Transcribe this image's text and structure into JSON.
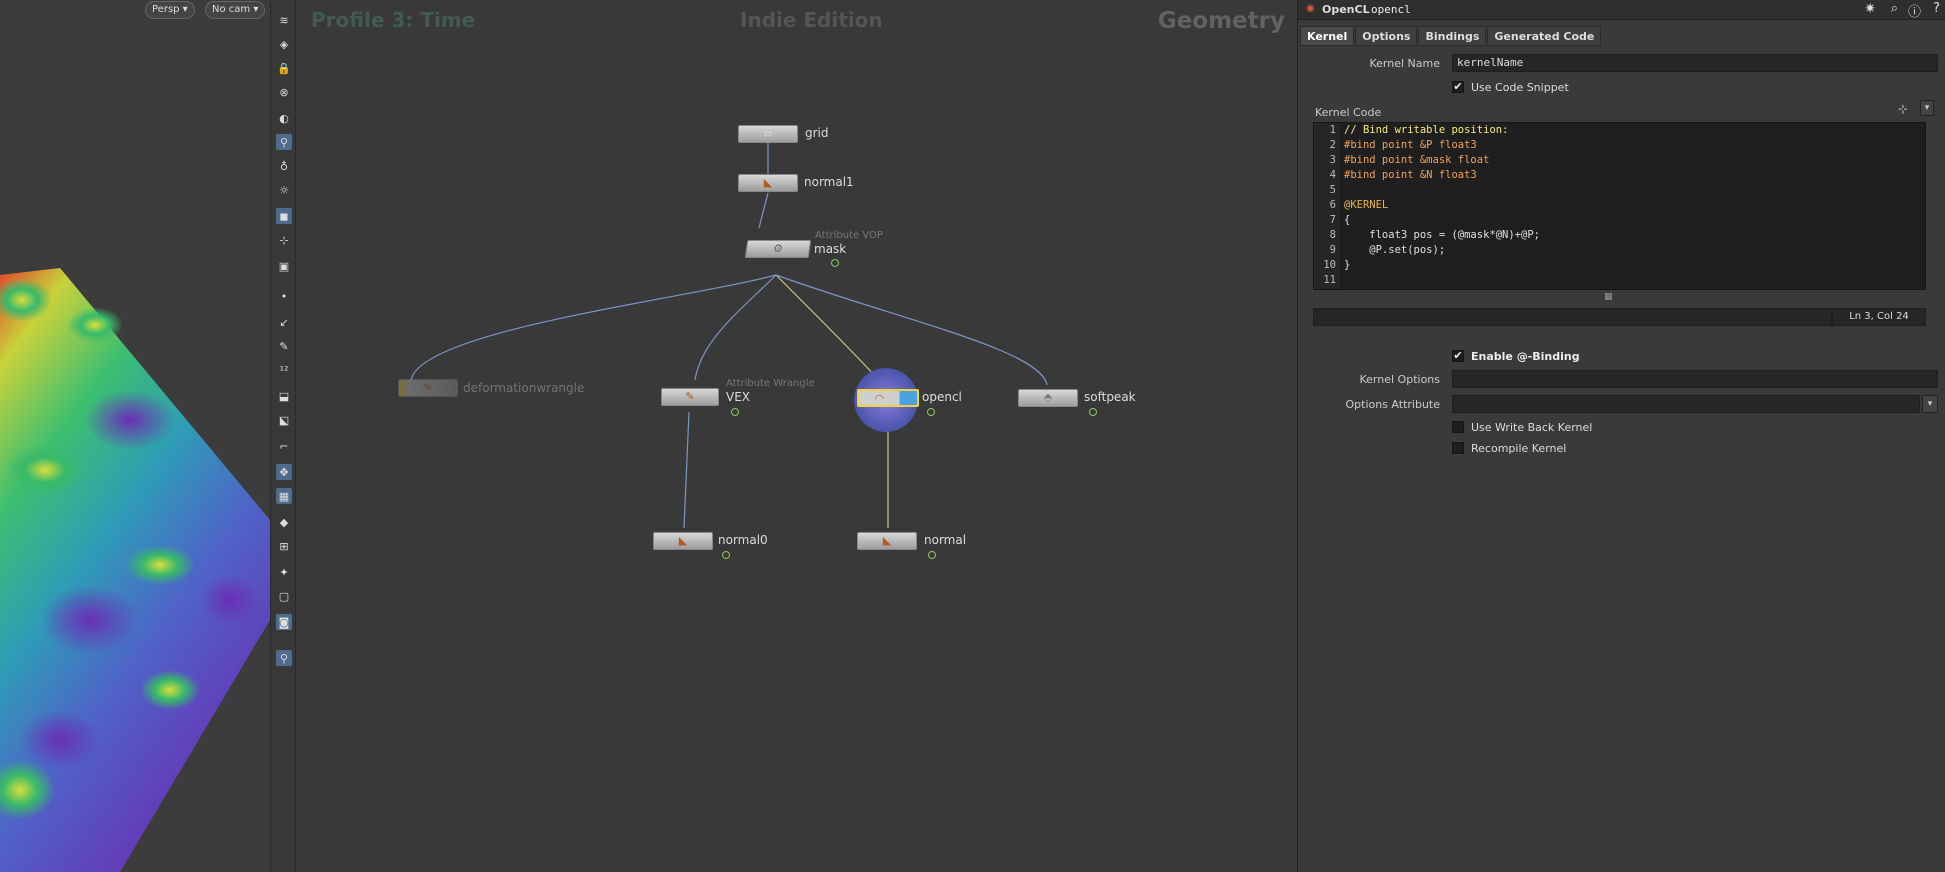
{
  "viewport": {
    "persp_label": "Persp",
    "cam_label": "No cam"
  },
  "network": {
    "overlay_left": "Profile 3: Time",
    "overlay_center": "Indie Edition",
    "overlay_right": "Geometry",
    "nodes": {
      "grid": "grid",
      "normal1": "normal1",
      "mask_type": "Attribute VOP",
      "mask": "mask",
      "deform": "deformationwrangle",
      "vex_type": "Attribute Wrangle",
      "vex": "VEX",
      "opencl": "opencl",
      "softpeak": "softpeak",
      "normal0": "normal0",
      "normal": "normal"
    }
  },
  "params": {
    "header": {
      "node_type": "OpenCL",
      "node_name": "opencl"
    },
    "tabs": [
      "Kernel",
      "Options",
      "Bindings",
      "Generated Code"
    ],
    "kernel_name_label": "Kernel Name",
    "kernel_name_value": "kernelName",
    "use_snippet_label": "Use Code Snippet",
    "kernel_code_label": "Kernel Code",
    "code_lines": [
      "// Bind writable position:",
      "#bind point &P float3",
      "#bind point &mask float",
      "#bind point &N float3",
      "",
      "@KERNEL",
      "{",
      "    float3 pos = (@mask*@N)+@P;",
      "    @P.set(pos);",
      "}",
      ""
    ],
    "line_numbers": [
      "1",
      "2",
      "3",
      "4",
      "5",
      "6",
      "7",
      "8",
      "9",
      "10",
      "11"
    ],
    "cursor_status": "Ln 3, Col 24",
    "enable_binding_label": "Enable @-Binding",
    "kernel_options_label": "Kernel Options",
    "options_attribute_label": "Options Attribute",
    "use_write_back_label": "Use Write Back Kernel",
    "recompile_label": "Recompile Kernel"
  },
  "colors": {
    "selected_node": "#4aa3e0",
    "flag_ring": "#8ec95a",
    "highlight_comment": "#f7e87a",
    "directive": "#f2a15a"
  }
}
